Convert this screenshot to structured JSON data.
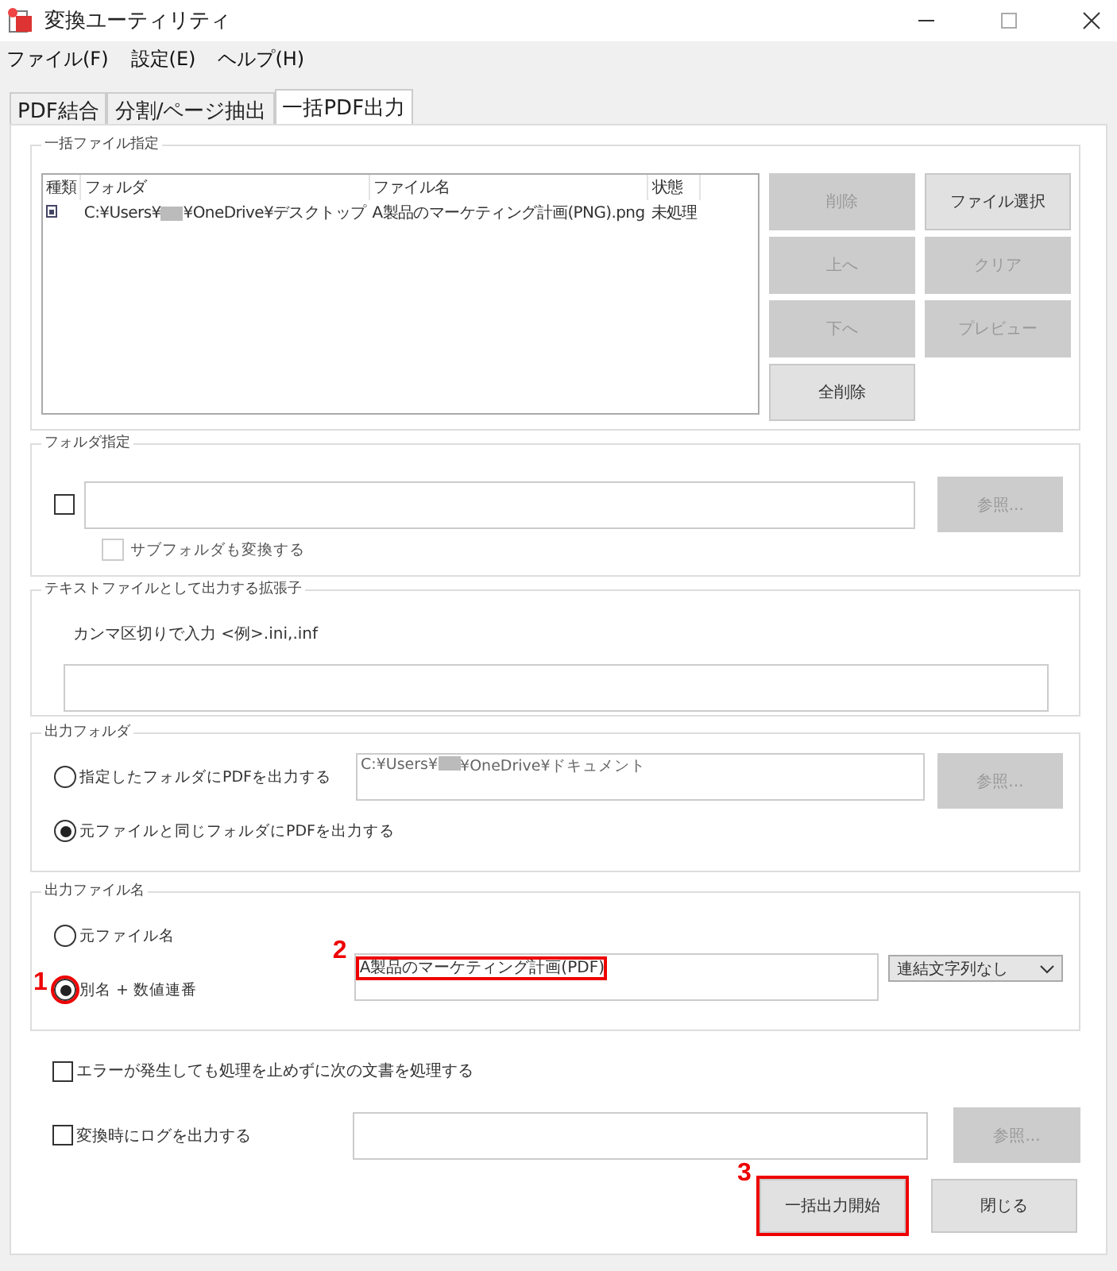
{
  "window": {
    "title": "変換ユーティリティ"
  },
  "menu": [
    "ファイル(F)",
    "設定(E)",
    "ヘルプ(H)"
  ],
  "tabs": [
    {
      "label": "PDF結合",
      "selected": false
    },
    {
      "label": "分割/ページ抽出",
      "selected": false
    },
    {
      "label": "一括PDF出力",
      "selected": true
    }
  ],
  "file_list_group": {
    "title": "一括ファイル指定",
    "columns": [
      "種類",
      "フォルダ",
      "ファイル名",
      "状態"
    ],
    "rows": [
      {
        "folder_before": "C:¥Users¥",
        "folder_after": "¥OneDrive¥デスクトップ",
        "file_name": "A製品のマーケティング計画(PNG).png",
        "status": "未処理"
      }
    ],
    "buttons": [
      {
        "label": "削除",
        "disabled": true
      },
      {
        "label": "ファイル選択",
        "disabled": false
      },
      {
        "label": "上へ",
        "disabled": true
      },
      {
        "label": "クリア",
        "disabled": true
      },
      {
        "label": "下へ",
        "disabled": true
      },
      {
        "label": "プレビュー",
        "disabled": true
      },
      {
        "label": "全削除",
        "disabled": false
      }
    ]
  },
  "folder_group": {
    "title": "フォルダ指定",
    "checked": false,
    "browse": {
      "label": "参照...",
      "disabled": true
    },
    "subfolder": {
      "label": "サブフォルダも変換する",
      "checked": false,
      "disabled": true
    }
  },
  "extension_group": {
    "title": "テキストファイルとして出力する拡張子",
    "hint": "カンマ区切りで入力 <例>.ini,.inf"
  },
  "output_folder_group": {
    "title": "出力フォルダ",
    "options": [
      {
        "label": "指定したフォルダにPDFを出力する",
        "selected": false
      },
      {
        "label": "元ファイルと同じフォルダにPDFを出力する",
        "selected": true
      }
    ],
    "path_before": "C:¥Users¥",
    "path_after": "¥OneDrive¥ドキュメント",
    "browse": {
      "label": "参照...",
      "disabled": true
    }
  },
  "output_name_group": {
    "title": "出力ファイル名",
    "options": [
      {
        "label": "元ファイル名",
        "selected": false
      },
      {
        "label": "別名 + 数値連番",
        "selected": true,
        "callout": "1"
      }
    ],
    "name_value": "A製品のマーケティング計画(PDF)",
    "name_callout": "2",
    "separator": "連結文字列なし"
  },
  "continue_on_error": {
    "label": "エラーが発生しても処理を止めずに次の文書を処理する",
    "checked": false
  },
  "log_output": {
    "label": "変換時にログを出力する",
    "checked": false,
    "browse": {
      "label": "参照...",
      "disabled": true
    }
  },
  "actions": [
    {
      "label": "一括出力開始",
      "callout": "3"
    },
    {
      "label": "閉じる"
    }
  ]
}
